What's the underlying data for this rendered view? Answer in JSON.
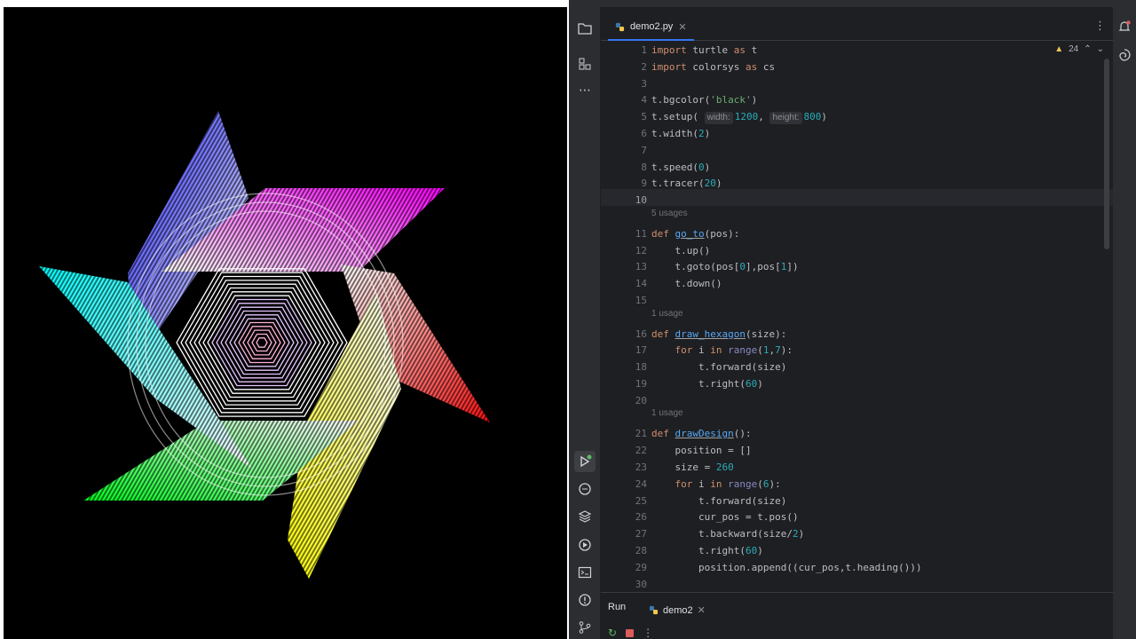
{
  "turtle_window": {
    "background": "#000000"
  },
  "editor": {
    "tab": {
      "label": "demo2.py",
      "icon": "python-file-icon"
    },
    "inspections": {
      "warning_count": "24"
    },
    "lines": [
      {
        "n": "1",
        "text": "import turtle as t"
      },
      {
        "n": "2",
        "text": "import colorsys as cs"
      },
      {
        "n": "3",
        "text": ""
      },
      {
        "n": "4",
        "text": "t.bgcolor('black')"
      },
      {
        "n": "5",
        "text": "t.setup( width: 1200, height: 800)"
      },
      {
        "n": "6",
        "text": "t.width(2)"
      },
      {
        "n": "7",
        "text": ""
      },
      {
        "n": "8",
        "text": "t.speed(0)"
      },
      {
        "n": "9",
        "text": "t.tracer(20)"
      },
      {
        "n": "10",
        "text": ""
      },
      {
        "n": "11",
        "text": "def go_to(pos):"
      },
      {
        "n": "12",
        "text": "    t.up()"
      },
      {
        "n": "13",
        "text": "    t.goto(pos[0],pos[1])"
      },
      {
        "n": "14",
        "text": "    t.down()"
      },
      {
        "n": "15",
        "text": ""
      },
      {
        "n": "16",
        "text": "def draw_hexagon(size):"
      },
      {
        "n": "17",
        "text": "    for i in range(1,7):"
      },
      {
        "n": "18",
        "text": "        t.forward(size)"
      },
      {
        "n": "19",
        "text": "        t.right(60)"
      },
      {
        "n": "20",
        "text": ""
      },
      {
        "n": "21",
        "text": "def drawDesign():"
      },
      {
        "n": "22",
        "text": "    position = []"
      },
      {
        "n": "23",
        "text": "    size = 260"
      },
      {
        "n": "24",
        "text": "    for i in range(6):"
      },
      {
        "n": "25",
        "text": "        t.forward(size)"
      },
      {
        "n": "26",
        "text": "        cur_pos = t.pos()"
      },
      {
        "n": "27",
        "text": "        t.backward(size/2)"
      },
      {
        "n": "28",
        "text": "        t.right(60)"
      },
      {
        "n": "29",
        "text": "        position.append((cur_pos,t.heading()))"
      },
      {
        "n": "30",
        "text": ""
      }
    ],
    "usages": {
      "go_to": "5 usages",
      "draw_hexagon": "1 usage",
      "drawDesign": "1 usage"
    },
    "param_hints": {
      "width": "width:",
      "height": "height:"
    }
  },
  "run_panel": {
    "title": "Run",
    "tab_label": "demo2"
  },
  "colors": {
    "keyword": "#cf8e6d",
    "number": "#2aacb8",
    "string": "#6aab73",
    "function": "#56a8f5",
    "accent": "#3574f0"
  }
}
